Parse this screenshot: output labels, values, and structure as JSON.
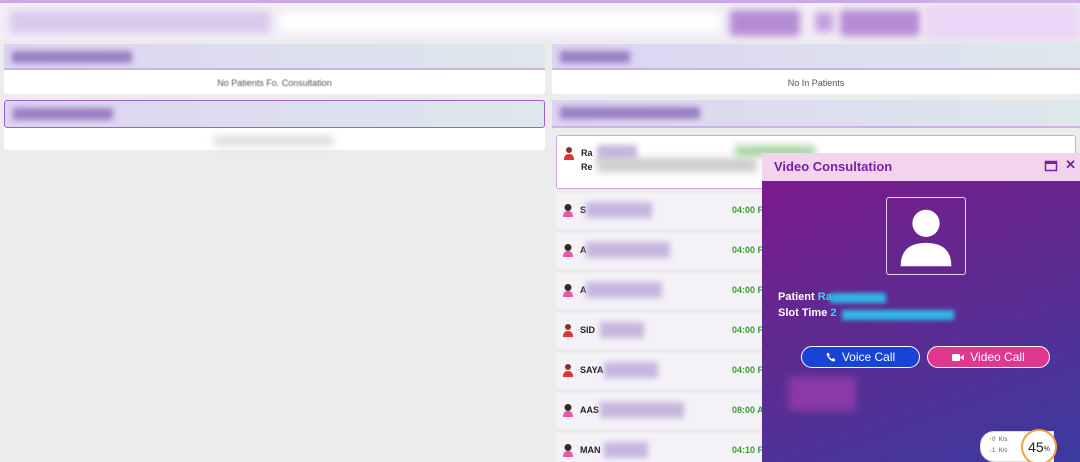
{
  "panels": {
    "no_patients_text": "No Patients Fo. Consultation",
    "no_in_patients_text": "No In Patients"
  },
  "queue": {
    "items": [
      {
        "name": "Ra",
        "sub": "Re",
        "time": "",
        "gender": "male"
      },
      {
        "name": "S",
        "time": "04:00 F",
        "gender": "female"
      },
      {
        "name": "A",
        "time": "04:00 F",
        "gender": "female"
      },
      {
        "name": "A",
        "time": "04:00 F",
        "gender": "female"
      },
      {
        "name": "SID",
        "time": "04:00 F",
        "gender": "male"
      },
      {
        "name": "SAYA",
        "time": "04:00 F",
        "gender": "male"
      },
      {
        "name": "AAS",
        "time": "08:00 A",
        "gender": "female"
      },
      {
        "name": "MAN",
        "time": "04:10 F",
        "gender": "female"
      }
    ]
  },
  "video_consultation": {
    "title": "Video Consultation",
    "patient_label": "Patient",
    "patient_value": "Ra",
    "slot_label": "Slot Time",
    "slot_value": "2",
    "voice_call_label": "Voice Call",
    "video_call_label": "Video Call",
    "colors": {
      "voice": "#1744d6",
      "video": "#e0378f",
      "title": "#7b1fa2"
    }
  },
  "network": {
    "up": "0",
    "up_unit": "K/s",
    "down": "1",
    "down_unit": "K/s",
    "percent": "45",
    "percent_unit": "%"
  }
}
